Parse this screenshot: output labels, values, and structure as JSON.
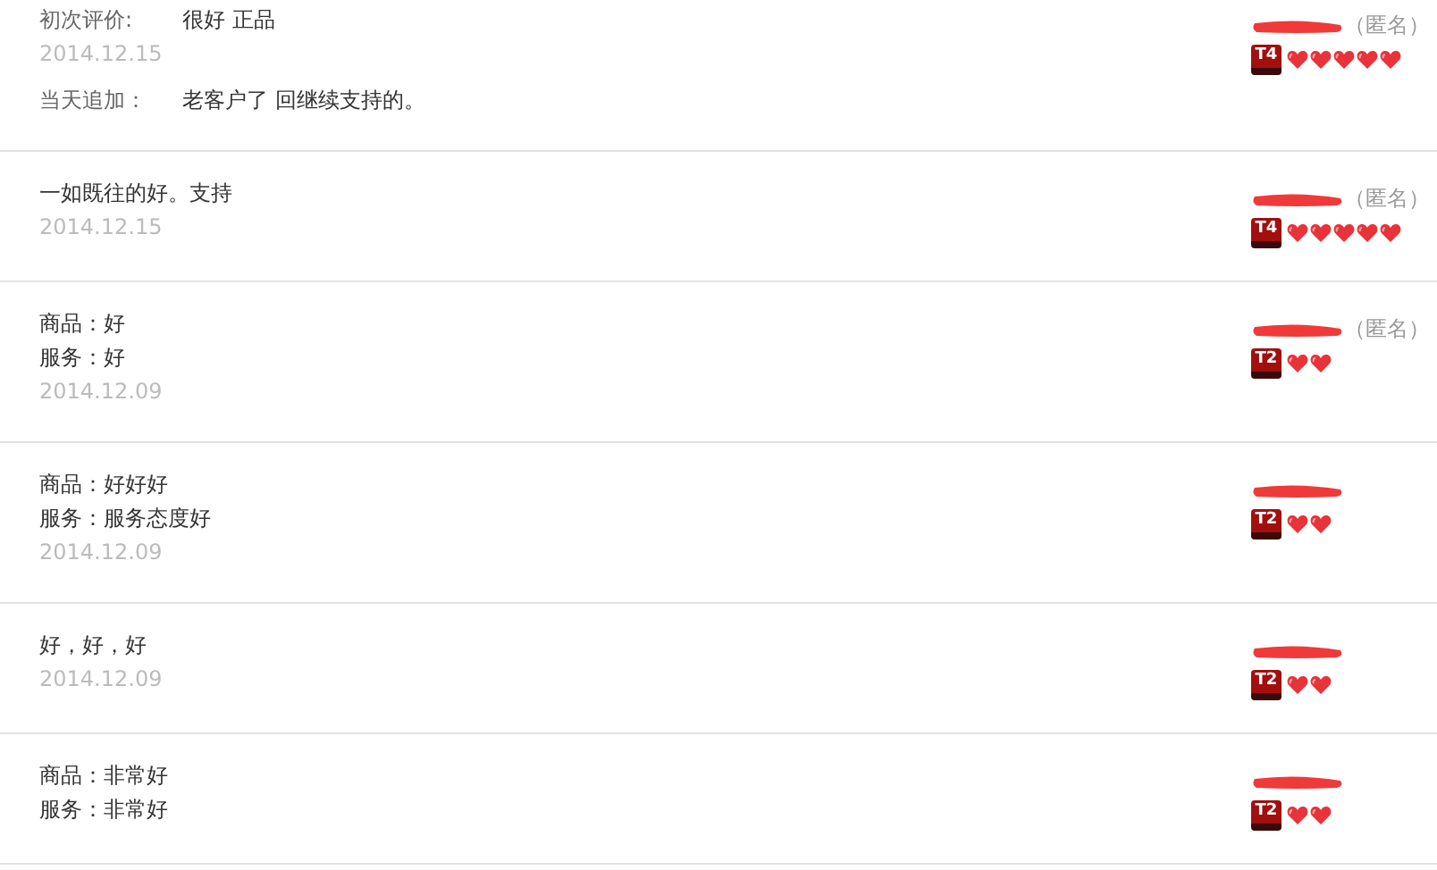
{
  "reviews": [
    {
      "kind": "labeled",
      "initial": {
        "label": "初次评价:",
        "text": "很好 正品",
        "date": "2014.12.15"
      },
      "followup": {
        "label": "当天追加：",
        "text": "老客户了 回继续支持的。"
      },
      "user": {
        "anonymous": "（匿名）",
        "badge": "T4",
        "grade_icons": [
          {
            "kind": "heart"
          },
          {
            "kind": "heart"
          },
          {
            "kind": "heart"
          },
          {
            "kind": "heart"
          },
          {
            "kind": "heart"
          }
        ]
      }
    },
    {
      "kind": "plain",
      "lines": [
        "一如既往的好。支持"
      ],
      "date": "2014.12.15",
      "user": {
        "anonymous": "（匿名）",
        "badge": "T4",
        "grade_icons": [
          {
            "kind": "heart"
          },
          {
            "kind": "heart"
          },
          {
            "kind": "heart"
          },
          {
            "kind": "heart"
          },
          {
            "kind": "heart"
          }
        ]
      }
    },
    {
      "kind": "plain",
      "lines": [
        "商品：好",
        "服务：好"
      ],
      "date": "2014.12.09",
      "user": {
        "anonymous": "（匿名）",
        "badge": "T2",
        "grade_icons": [
          {
            "kind": "heart"
          },
          {
            "kind": "heart"
          }
        ]
      }
    },
    {
      "kind": "plain",
      "lines": [
        "商品：好好好",
        "服务：服务态度好"
      ],
      "date": "2014.12.09",
      "user": {
        "badge": "T2",
        "grade_icons": [
          {
            "kind": "heart"
          },
          {
            "kind": "heart"
          }
        ]
      }
    },
    {
      "kind": "plain",
      "lines": [
        "好，好，好"
      ],
      "date": "2014.12.09",
      "user": {
        "badge": "T2",
        "grade_icons": [
          {
            "kind": "heart"
          },
          {
            "kind": "heart"
          }
        ]
      }
    },
    {
      "kind": "plain",
      "lines": [
        "商品：非常好",
        "服务：非常好"
      ],
      "user": {
        "badge": "T2",
        "grade_icons": [
          {
            "kind": "heart"
          },
          {
            "kind": "heart"
          }
        ]
      }
    }
  ]
}
